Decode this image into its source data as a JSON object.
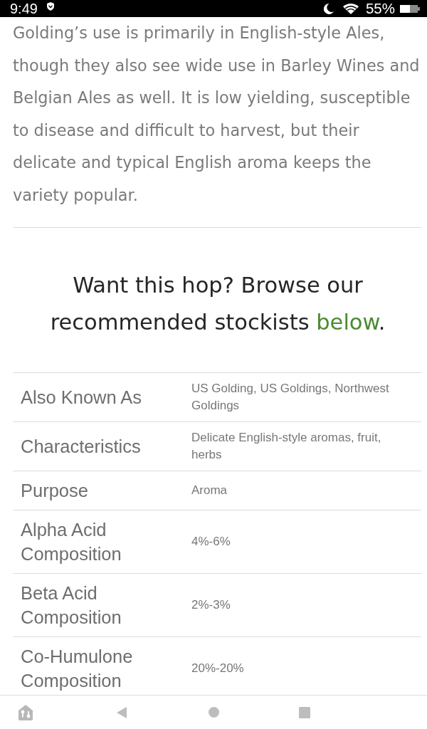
{
  "status_bar": {
    "time": "9:49",
    "battery": "55%"
  },
  "article": {
    "paragraph": "Golding’s use is primarily in English-style Ales, though they also see wide use in Barley Wines and Belgian Ales as well. It is low yielding, susceptible to disease and difficult to harvest, but their delicate and typical English aroma keeps the variety popular."
  },
  "callout": {
    "text": "Want this hop? Browse our recommended stockists",
    "link": "below",
    "end": "."
  },
  "table": {
    "rows": [
      {
        "label": "Also Known As",
        "value": "US Golding, US Goldings, Northwest Goldings"
      },
      {
        "label": "Characteristics",
        "value": "Delicate English-style aromas, fruit, herbs"
      },
      {
        "label": "Purpose",
        "value": "Aroma"
      },
      {
        "label": "Alpha Acid Composition",
        "value": "4%-6%"
      },
      {
        "label": "Beta Acid Composition",
        "value": "2%-3%"
      },
      {
        "label": "Co-Humulone Composition",
        "value": "20%-20%"
      }
    ]
  }
}
